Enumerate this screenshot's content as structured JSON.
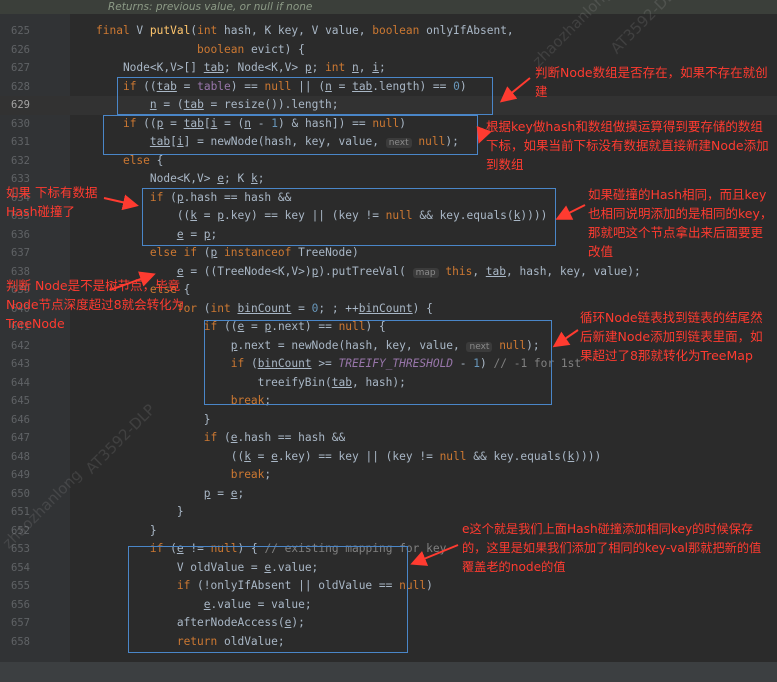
{
  "doc_comment": "Returns: previous value, or null if none",
  "gutter_lines": [
    "625",
    "626",
    "627",
    "628",
    "629",
    "630",
    "631",
    "632",
    "633",
    "634",
    "635",
    "636",
    "637",
    "638",
    "639",
    "640",
    "641",
    "642",
    "643",
    "644",
    "645",
    "646",
    "647",
    "648",
    "649",
    "650",
    "651",
    "652",
    "653",
    "654",
    "655",
    "656",
    "657",
    "658"
  ],
  "code_lines": [
    {
      "ln": "625"
    },
    {
      "ln": "626"
    },
    {
      "ln": "627"
    },
    {
      "ln": "628"
    },
    {
      "ln": "629"
    },
    {
      "ln": "630"
    },
    {
      "ln": "631"
    },
    {
      "ln": "632"
    },
    {
      "ln": "633"
    },
    {
      "ln": "634"
    },
    {
      "ln": "635"
    },
    {
      "ln": "636"
    },
    {
      "ln": "637"
    },
    {
      "ln": "638"
    },
    {
      "ln": "639"
    },
    {
      "ln": "640"
    },
    {
      "ln": "641"
    },
    {
      "ln": "642"
    },
    {
      "ln": "643"
    },
    {
      "ln": "644"
    },
    {
      "ln": "645"
    },
    {
      "ln": "646"
    },
    {
      "ln": "647"
    },
    {
      "ln": "648"
    },
    {
      "ln": "649"
    },
    {
      "ln": "650"
    },
    {
      "ln": "651"
    },
    {
      "ln": "652"
    },
    {
      "ln": "653"
    },
    {
      "ln": "654"
    },
    {
      "ln": "655"
    },
    {
      "ln": "656"
    },
    {
      "ln": "657"
    },
    {
      "ln": "658"
    }
  ],
  "hints": {
    "value": "value",
    "next": "next",
    "map": "map"
  },
  "annotations": {
    "a1": "判断Node数组是否存在，如果不存在就创建",
    "a2": "根据key做hash和数组做摸运算得到要存储的数组下标，如果当前下标没有数据就直接新建Node添加到数组",
    "a3": "如果 下标有数据Hash碰撞了",
    "a4": "如果碰撞的Hash相同，而且key也相同说明添加的是相同的key，那就吧这个节点拿出来后面要更改值",
    "a5": "判断 Node是不是树节点，毕竟Node节点深度超过8就会转化为TreeNode",
    "a6": "循环Node链表找到链表的结尾然后新建Node添加到链表里面，如果超过了8那就转化为TreeMap",
    "a7": "e这个就是我们上面Hash碰撞添加相同key的时候保存的，这里是如果我们添加了相同的key-val那就把新的值覆盖老的node的值"
  },
  "watermarks": [
    "zhaozhanlong",
    "AT3592-DLP"
  ],
  "colors": {
    "annotation": "#ff3b30",
    "box": "#4a86c8",
    "keyword": "#cc7832",
    "method": "#ffc66d",
    "number": "#6897bb",
    "background": "#2b2b2b"
  }
}
